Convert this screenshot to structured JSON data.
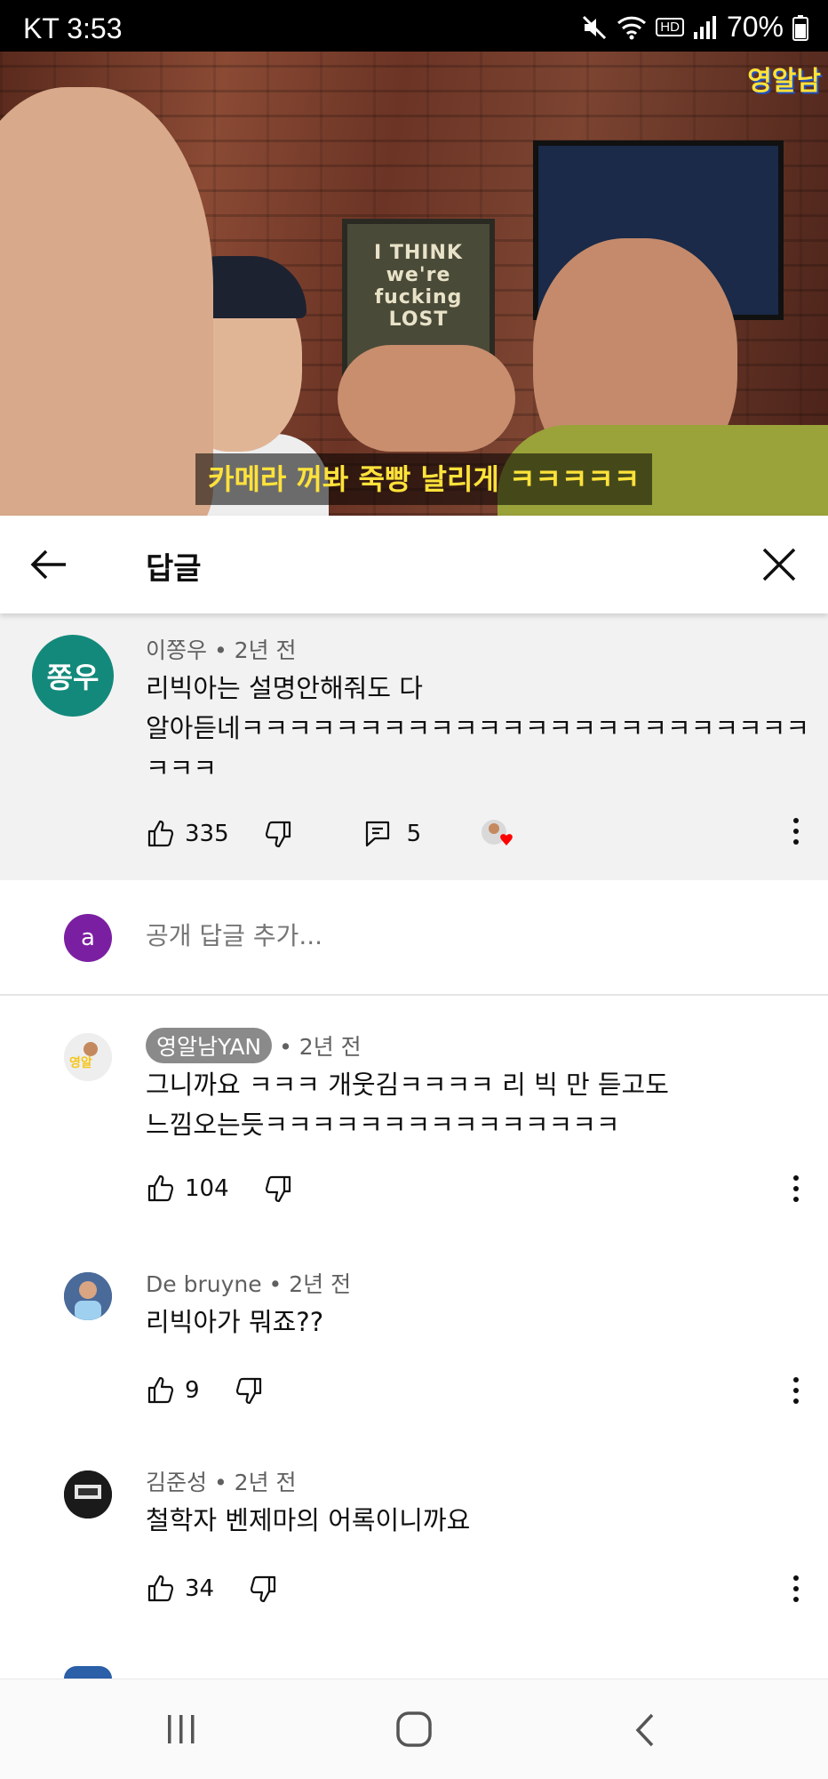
{
  "status_bar": {
    "carrier_time": "KT 3:53",
    "network": "HD",
    "battery": "70%"
  },
  "video": {
    "subtitle": "카메라 꺼봐 죽빵 날리게 ㅋㅋㅋㅋㅋ",
    "channel_logo": "영알남",
    "poster_text": "I THINK we're fucking LOST",
    "progress_fraction": 0.89
  },
  "header": {
    "title": "답글"
  },
  "top_comment": {
    "avatar_text": "쫑우",
    "author": "이쫑우",
    "age": "2년 전",
    "lines": [
      "리빅아는 설명안해줘도 다",
      "알아듣네ㅋㅋㅋㅋㅋㅋㅋㅋㅋㅋㅋㅋㅋㅋㅋㅋㅋㅋㅋㅋㅋㅋㅋㅋ",
      "ㅋㅋㅋ"
    ],
    "likes": "335",
    "reply_count": "5"
  },
  "add_reply": {
    "avatar_letter": "a",
    "placeholder": "공개 답글 추가..."
  },
  "replies": [
    {
      "author": "영알남YAN",
      "age": "2년 전",
      "lines": [
        "그니까요 ㅋㅋㅋ 개웃김ㅋㅋㅋㅋ 리 빅 만 듣고도",
        "느낌오는듯ㅋㅋㅋㅋㅋㅋㅋㅋㅋㅋㅋㅋㅋㅋㅋ"
      ],
      "likes": "104"
    },
    {
      "author": "De bruyne",
      "age": "2년 전",
      "lines": [
        "리빅아가 뭐죠??"
      ],
      "likes": "9"
    },
    {
      "author": "김준성",
      "age": "2년 전",
      "lines": [
        "철학자 벤제마의 어록이니까요"
      ],
      "likes": "34"
    }
  ]
}
